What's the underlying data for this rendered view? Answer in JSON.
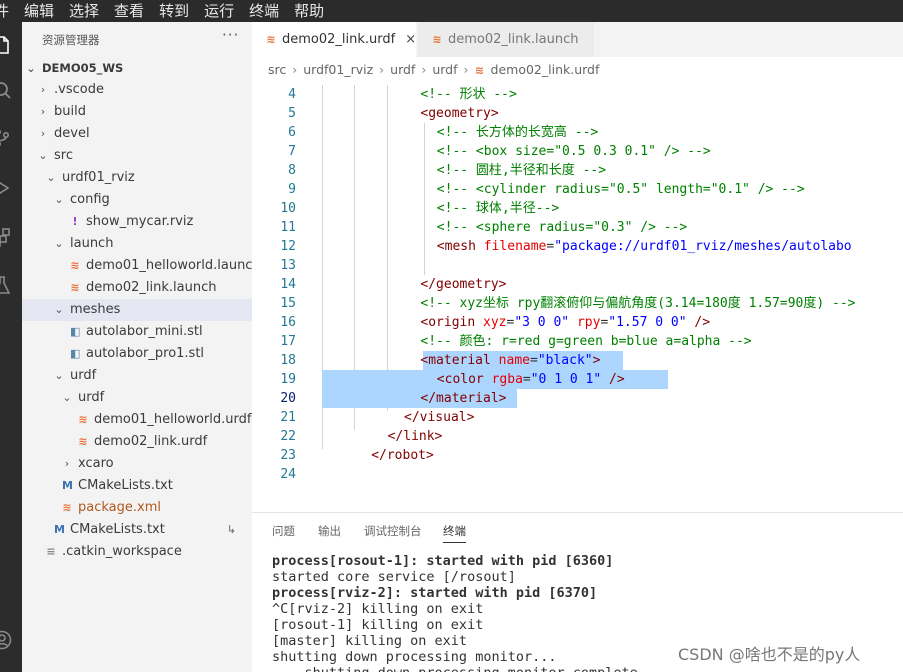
{
  "menubar": [
    "件",
    "编辑",
    "选择",
    "查看",
    "转到",
    "运行",
    "终端",
    "帮助"
  ],
  "activity_icons": [
    "files-icon",
    "search-icon",
    "source-control-icon",
    "run-debug-icon",
    "extensions-icon",
    "test-icon",
    "account-icon"
  ],
  "explorer": {
    "title": "资源管理器",
    "more": "···",
    "workspace": "DEMO05_WS",
    "items": [
      {
        "label": ".vscode",
        "kind": "folder",
        "open": false,
        "level": 1
      },
      {
        "label": "build",
        "kind": "folder",
        "open": false,
        "level": 1
      },
      {
        "label": "devel",
        "kind": "folder",
        "open": false,
        "level": 1
      },
      {
        "label": "src",
        "kind": "folder",
        "open": true,
        "level": 1
      },
      {
        "label": "urdf01_rviz",
        "kind": "folder",
        "open": true,
        "level": 2
      },
      {
        "label": "config",
        "kind": "folder",
        "open": true,
        "level": 3
      },
      {
        "label": "show_mycar.rviz",
        "kind": "rviz",
        "level": 4
      },
      {
        "label": "launch",
        "kind": "folder",
        "open": true,
        "level": 3
      },
      {
        "label": "demo01_helloworld.launch",
        "kind": "launch",
        "level": 4
      },
      {
        "label": "demo02_link.launch",
        "kind": "launch",
        "level": 4
      },
      {
        "label": "meshes",
        "kind": "folder",
        "open": true,
        "level": 3,
        "selected": true
      },
      {
        "label": "autolabor_mini.stl",
        "kind": "stl",
        "level": 4
      },
      {
        "label": "autolabor_pro1.stl",
        "kind": "stl",
        "level": 4
      },
      {
        "label": "urdf",
        "kind": "folder",
        "open": true,
        "level": 3
      },
      {
        "label": "urdf",
        "kind": "folder",
        "open": true,
        "level": 4
      },
      {
        "label": "demo01_helloworld.urdf",
        "kind": "launch",
        "level": 5
      },
      {
        "label": "demo02_link.urdf",
        "kind": "launch",
        "level": 5
      },
      {
        "label": "xcaro",
        "kind": "folder",
        "open": false,
        "level": 4
      },
      {
        "label": "CMakeLists.txt",
        "kind": "cmake",
        "level": 3
      },
      {
        "label": "package.xml",
        "kind": "xml",
        "level": 3
      },
      {
        "label": "CMakeLists.txt",
        "kind": "cmake",
        "level": 2,
        "badge": "↳"
      },
      {
        "label": ".catkin_workspace",
        "kind": "plain",
        "level": 1
      }
    ]
  },
  "tabs": [
    {
      "label": "demo02_link.urdf",
      "active": true,
      "close": "×"
    },
    {
      "label": "demo02_link.launch",
      "active": false
    }
  ],
  "breadcrumb": [
    "src",
    "urdf01_rviz",
    "urdf",
    "urdf",
    "demo02_link.urdf"
  ],
  "code": {
    "current_line": 20,
    "lines": [
      {
        "n": "4",
        "indent": 24,
        "parts": [
          {
            "t": "<!-- 形状 -->",
            "c": "com"
          }
        ]
      },
      {
        "n": "5",
        "indent": 24,
        "parts": [
          {
            "t": "<geometry>",
            "c": "tag"
          }
        ]
      },
      {
        "n": "6",
        "indent": 28,
        "parts": [
          {
            "t": "<!-- 长方体的长宽高 -->",
            "c": "com"
          }
        ]
      },
      {
        "n": "7",
        "indent": 28,
        "parts": [
          {
            "t": "<!-- <box size=\"0.5 0.3 0.1\" /> -->",
            "c": "com"
          }
        ]
      },
      {
        "n": "8",
        "indent": 28,
        "parts": [
          {
            "t": "<!-- 圆柱,半径和长度 -->",
            "c": "com"
          }
        ]
      },
      {
        "n": "9",
        "indent": 28,
        "parts": [
          {
            "t": "<!-- <cylinder radius=\"0.5\" length=\"0.1\" /> -->",
            "c": "com"
          }
        ]
      },
      {
        "n": "10",
        "indent": 28,
        "parts": [
          {
            "t": "<!-- 球体,半径-->",
            "c": "com"
          }
        ]
      },
      {
        "n": "11",
        "indent": 28,
        "parts": [
          {
            "t": "<!-- <sphere radius=\"0.3\" /> -->",
            "c": "com"
          }
        ]
      },
      {
        "n": "12",
        "indent": 28,
        "parts": [
          {
            "t": "<mesh ",
            "c": "tag"
          },
          {
            "t": "filename",
            "c": "attr"
          },
          {
            "t": "=",
            "c": "txt"
          },
          {
            "t": "\"package://urdf01_rviz/meshes/autolabo",
            "c": "str"
          }
        ]
      },
      {
        "n": "13",
        "indent": 0,
        "parts": []
      },
      {
        "n": "14",
        "indent": 24,
        "parts": [
          {
            "t": "</geometry>",
            "c": "tag"
          }
        ]
      },
      {
        "n": "15",
        "indent": 24,
        "parts": [
          {
            "t": "<!-- xyz坐标 rpy翻滚俯仰与偏航角度(3.14=180度 1.57=90度) -->",
            "c": "com"
          }
        ]
      },
      {
        "n": "16",
        "indent": 24,
        "parts": [
          {
            "t": "<origin ",
            "c": "tag"
          },
          {
            "t": "xyz",
            "c": "attr"
          },
          {
            "t": "=",
            "c": "txt"
          },
          {
            "t": "\"3 0 0\"",
            "c": "str"
          },
          {
            "t": " ",
            "c": "txt"
          },
          {
            "t": "rpy",
            "c": "attr"
          },
          {
            "t": "=",
            "c": "txt"
          },
          {
            "t": "\"1.57 0 0\"",
            "c": "str"
          },
          {
            "t": " />",
            "c": "tag"
          }
        ]
      },
      {
        "n": "17",
        "indent": 24,
        "parts": [
          {
            "t": "<!-- 颜色: r=red g=green b=blue a=alpha -->",
            "c": "com"
          }
        ]
      },
      {
        "n": "18",
        "indent": 24,
        "parts": [
          {
            "t": "<material ",
            "c": "tag"
          },
          {
            "t": "name",
            "c": "attr"
          },
          {
            "t": "=",
            "c": "txt"
          },
          {
            "t": "\"black\"",
            "c": "str"
          },
          {
            "t": ">",
            "c": "tag"
          }
        ]
      },
      {
        "n": "19",
        "indent": 28,
        "parts": [
          {
            "t": "<color ",
            "c": "tag"
          },
          {
            "t": "rgba",
            "c": "attr"
          },
          {
            "t": "=",
            "c": "txt"
          },
          {
            "t": "\"0 1 0 1\"",
            "c": "str"
          },
          {
            "t": " />",
            "c": "tag"
          }
        ]
      },
      {
        "n": "20",
        "indent": 24,
        "parts": [
          {
            "t": "</material>",
            "c": "tag"
          }
        ]
      },
      {
        "n": "21",
        "indent": 20,
        "parts": [
          {
            "t": "</visual>",
            "c": "tag"
          }
        ]
      },
      {
        "n": "22",
        "indent": 16,
        "parts": [
          {
            "t": "</link>",
            "c": "tag"
          }
        ]
      },
      {
        "n": "23",
        "indent": 12,
        "parts": [
          {
            "t": "</robot>",
            "c": "tag"
          }
        ]
      },
      {
        "n": "24",
        "indent": 0,
        "parts": []
      }
    ]
  },
  "panel": {
    "tabs": [
      "问题",
      "输出",
      "调试控制台",
      "终端"
    ],
    "active_tab": "终端",
    "terminal": [
      {
        "t": "process[rosout-1]: started with pid [6360]",
        "bold": true
      },
      {
        "t": "started core service [/rosout]",
        "bold": false
      },
      {
        "t": "process[rviz-2]: started with pid [6370]",
        "bold": true
      },
      {
        "t": "^C[rviz-2] killing on exit",
        "bold": false
      },
      {
        "t": "[rosout-1] killing on exit",
        "bold": false
      },
      {
        "t": "[master] killing on exit",
        "bold": false
      },
      {
        "t": "shutting down processing monitor...",
        "bold": false
      },
      {
        "t": "... shutting down processing monitor complete",
        "bold": false
      }
    ]
  },
  "watermark": "CSDN @啥也不是的py人"
}
